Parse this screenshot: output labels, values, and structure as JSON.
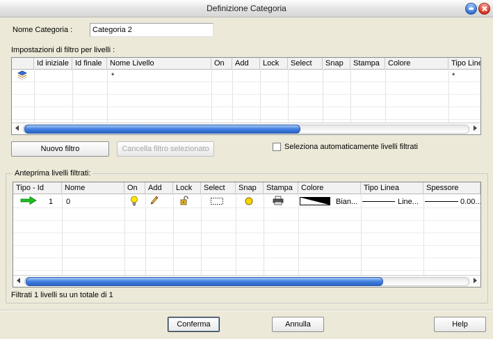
{
  "window": {
    "title": "Definizione Categoria"
  },
  "name_field": {
    "label": "Nome Categoria :",
    "value": "Categoria 2"
  },
  "filter_section": {
    "label": "Impostazioni di filtro per livelli :",
    "columns": [
      "Id iniziale",
      "Id finale",
      "Nome Livello",
      "On",
      "Add",
      "Lock",
      "Select",
      "Snap",
      "Stampa",
      "Colore",
      "Tipo Linea"
    ],
    "row": {
      "icon": "layer-stack-icon",
      "nome_livello": "*",
      "tipo_linea": "*"
    }
  },
  "buttons": {
    "new_filter": "Nuovo filtro",
    "delete_filter": "Cancella filtro selezionato",
    "confirm": "Conferma",
    "cancel": "Annulla",
    "help": "Help"
  },
  "auto_select": {
    "label": "Seleziona automaticamente livelli filtrati",
    "checked": false
  },
  "preview": {
    "label": "Anteprima livelli filtrati:",
    "columns": [
      "Tipo - Id",
      "Nome",
      "On",
      "Add",
      "Lock",
      "Select",
      "Snap",
      "Stampa",
      "Colore",
      "Tipo Linea",
      "Spessore"
    ],
    "rows": [
      {
        "type_icon": "green-arrow-icon",
        "id": "1",
        "nome": "0",
        "on_icon": "lightbulb-icon",
        "add_icon": "pencil-icon",
        "lock_icon": "unlocked-padlock-icon",
        "select_icon": "selection-rectangle-icon",
        "snap_icon": "snap-dot-icon",
        "stampa_icon": "printer-icon",
        "colore": "Bian...",
        "tipo_linea": "Line...",
        "spessore": "0.00..."
      }
    ]
  },
  "status": "Filtrati 1 livelli su un totale di 1",
  "colors": {
    "accent_blue": "#3f7fe0",
    "background": "#ece9d8",
    "arrow_green": "#1fbf1f",
    "snap_yellow": "#ffd400"
  }
}
